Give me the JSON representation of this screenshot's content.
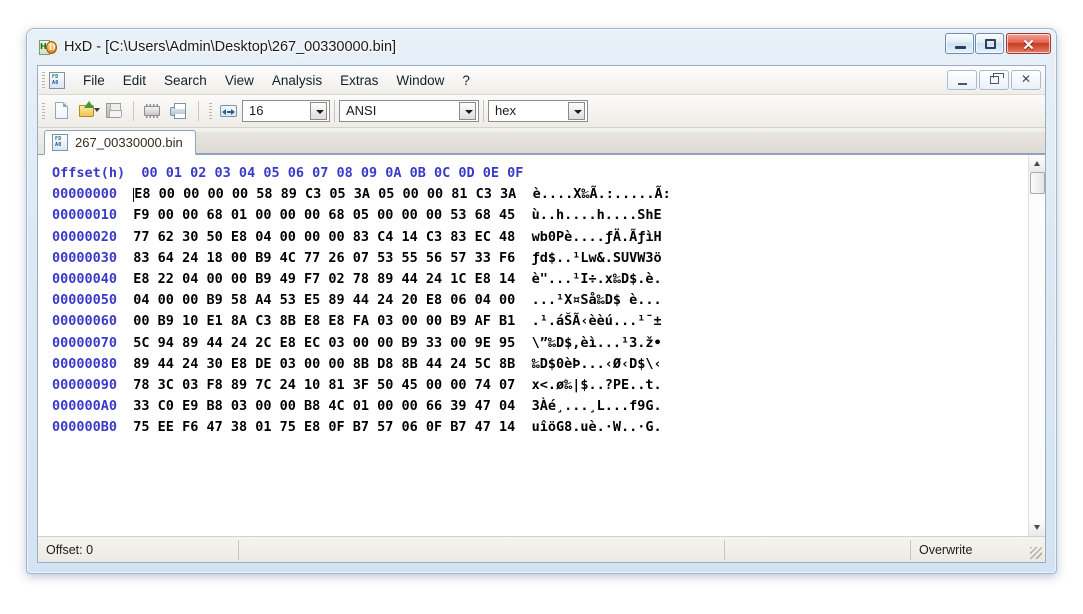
{
  "window": {
    "title": "HxD - [C:\\Users\\Admin\\Desktop\\267_00330000.bin]",
    "logo_hx": "Hx",
    "logo_d": "D",
    "minimize_label": "–",
    "maximize_label": "❐",
    "close_label": "✕"
  },
  "menubar": {
    "items": [
      {
        "label": "File"
      },
      {
        "label": "Edit"
      },
      {
        "label": "Search"
      },
      {
        "label": "View"
      },
      {
        "label": "Analysis"
      },
      {
        "label": "Extras"
      },
      {
        "label": "Window"
      },
      {
        "label": "?"
      }
    ],
    "mdi": {
      "minimize_label": "–",
      "restore_label": "❐",
      "close_label": "✕"
    }
  },
  "toolbar": {
    "icons": [
      {
        "name": "new-file-icon"
      },
      {
        "name": "open-file-icon"
      },
      {
        "name": "save-file-icon"
      },
      {
        "name": "memory-chip-icon"
      },
      {
        "name": "print-icon"
      },
      {
        "name": "bytes-per-row-icon"
      }
    ],
    "bytes_per_row": "16",
    "encoding": "ANSI",
    "offset_base": "hex"
  },
  "tabs": [
    {
      "label": "267_00330000.bin",
      "icon_top": "FD",
      "icon_bottom": "A0",
      "active": true
    }
  ],
  "hexview": {
    "offset_header": "Offset(h)",
    "column_headers": [
      "00",
      "01",
      "02",
      "03",
      "04",
      "05",
      "06",
      "07",
      "08",
      "09",
      "0A",
      "0B",
      "0C",
      "0D",
      "0E",
      "0F"
    ],
    "rows": [
      {
        "offset": "00000000",
        "bytes": [
          "E8",
          "00",
          "00",
          "00",
          "00",
          "58",
          "89",
          "C3",
          "05",
          "3A",
          "05",
          "00",
          "00",
          "81",
          "C3",
          "3A"
        ],
        "ascii": "è....X‰Ã.:.....Ã:"
      },
      {
        "offset": "00000010",
        "bytes": [
          "F9",
          "00",
          "00",
          "68",
          "01",
          "00",
          "00",
          "00",
          "68",
          "05",
          "00",
          "00",
          "00",
          "53",
          "68",
          "45"
        ],
        "ascii": "ù..h....h....ShE"
      },
      {
        "offset": "00000020",
        "bytes": [
          "77",
          "62",
          "30",
          "50",
          "E8",
          "04",
          "00",
          "00",
          "00",
          "83",
          "C4",
          "14",
          "C3",
          "83",
          "EC",
          "48"
        ],
        "ascii": "wb0Pè....ƒÄ.ÃƒìH"
      },
      {
        "offset": "00000030",
        "bytes": [
          "83",
          "64",
          "24",
          "18",
          "00",
          "B9",
          "4C",
          "77",
          "26",
          "07",
          "53",
          "55",
          "56",
          "57",
          "33",
          "F6"
        ],
        "ascii": "ƒd$..¹Lw&.SUVW3ö"
      },
      {
        "offset": "00000040",
        "bytes": [
          "E8",
          "22",
          "04",
          "00",
          "00",
          "B9",
          "49",
          "F7",
          "02",
          "78",
          "89",
          "44",
          "24",
          "1C",
          "E8",
          "14"
        ],
        "ascii": "è\"...¹I÷.x‰D$.è."
      },
      {
        "offset": "00000050",
        "bytes": [
          "04",
          "00",
          "00",
          "B9",
          "58",
          "A4",
          "53",
          "E5",
          "89",
          "44",
          "24",
          "20",
          "E8",
          "06",
          "04",
          "00"
        ],
        "ascii": "...¹X¤Så‰D$ è..."
      },
      {
        "offset": "00000060",
        "bytes": [
          "00",
          "B9",
          "10",
          "E1",
          "8A",
          "C3",
          "8B",
          "E8",
          "E8",
          "FA",
          "03",
          "00",
          "00",
          "B9",
          "AF",
          "B1"
        ],
        "ascii": ".¹.áŠÃ‹èèú...¹¯±"
      },
      {
        "offset": "00000070",
        "bytes": [
          "5C",
          "94",
          "89",
          "44",
          "24",
          "2C",
          "E8",
          "EC",
          "03",
          "00",
          "00",
          "B9",
          "33",
          "00",
          "9E",
          "95"
        ],
        "ascii": "\\”‰D$,èì...¹3.ž•"
      },
      {
        "offset": "00000080",
        "bytes": [
          "89",
          "44",
          "24",
          "30",
          "E8",
          "DE",
          "03",
          "00",
          "00",
          "8B",
          "D8",
          "8B",
          "44",
          "24",
          "5C",
          "8B"
        ],
        "ascii": "‰D$0èÞ...‹Ø‹D$\\‹"
      },
      {
        "offset": "00000090",
        "bytes": [
          "78",
          "3C",
          "03",
          "F8",
          "89",
          "7C",
          "24",
          "10",
          "81",
          "3F",
          "50",
          "45",
          "00",
          "00",
          "74",
          "07"
        ],
        "ascii": "x<.ø‰|$..?PE..t."
      },
      {
        "offset": "000000A0",
        "bytes": [
          "33",
          "C0",
          "E9",
          "B8",
          "03",
          "00",
          "00",
          "B8",
          "4C",
          "01",
          "00",
          "00",
          "66",
          "39",
          "47",
          "04"
        ],
        "ascii": "3Àé¸...¸L...f9G."
      },
      {
        "offset": "000000B0",
        "bytes": [
          "75",
          "EE",
          "F6",
          "47",
          "38",
          "01",
          "75",
          "E8",
          "0F",
          "B7",
          "57",
          "06",
          "0F",
          "B7",
          "47",
          "14"
        ],
        "ascii": "uîöG8.uè.·W..·G."
      }
    ]
  },
  "scrollbar": {
    "up_arrow": "▲",
    "down_arrow": "▼"
  },
  "statusbar": {
    "offset_label": "Offset: 0",
    "cell2": "",
    "cell3": "",
    "cell4": "",
    "mode_label": "Overwrite"
  },
  "colors": {
    "offset_blue": "#3a3ac8",
    "byte_black": "#000000",
    "title_text": "#1b1b1b",
    "close_red": "#c63b21",
    "frame_blue": "#9fb8d4"
  }
}
